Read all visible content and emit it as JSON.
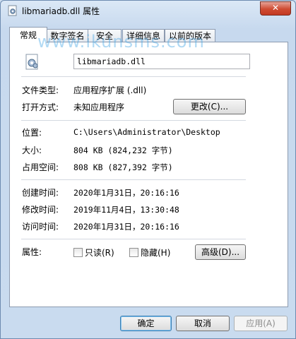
{
  "window": {
    "title": "libmariadb.dll 属性",
    "close_label": "✕"
  },
  "tabs": [
    {
      "label": "常规"
    },
    {
      "label": "数字签名"
    },
    {
      "label": "安全"
    },
    {
      "label": "详细信息"
    },
    {
      "label": "以前的版本"
    }
  ],
  "watermark": "www.ikunsms.com",
  "file": {
    "name": "libmariadb.dll"
  },
  "props": {
    "type_label": "文件类型:",
    "type_value": "应用程序扩展 (.dll)",
    "open_label": "打开方式:",
    "open_value": "未知应用程序",
    "change_button": "更改(C)...",
    "location_label": "位置:",
    "location_value": "C:\\Users\\Administrator\\Desktop",
    "size_label": "大小:",
    "size_value": "804 KB (824,232 字节)",
    "disk_label": "占用空间:",
    "disk_value": "808 KB (827,392 字节)",
    "created_label": "创建时间:",
    "created_value": "2020年1月31日，20:16:16",
    "modified_label": "修改时间:",
    "modified_value": "2019年11月4日，13:30:48",
    "accessed_label": "访问时间:",
    "accessed_value": "2020年1月31日，20:16:16",
    "attr_label": "属性:",
    "readonly_label": "只读(R)",
    "hidden_label": "隐藏(H)",
    "advanced_button": "高级(D)..."
  },
  "footer": {
    "ok": "确定",
    "cancel": "取消",
    "apply": "应用(A)"
  }
}
